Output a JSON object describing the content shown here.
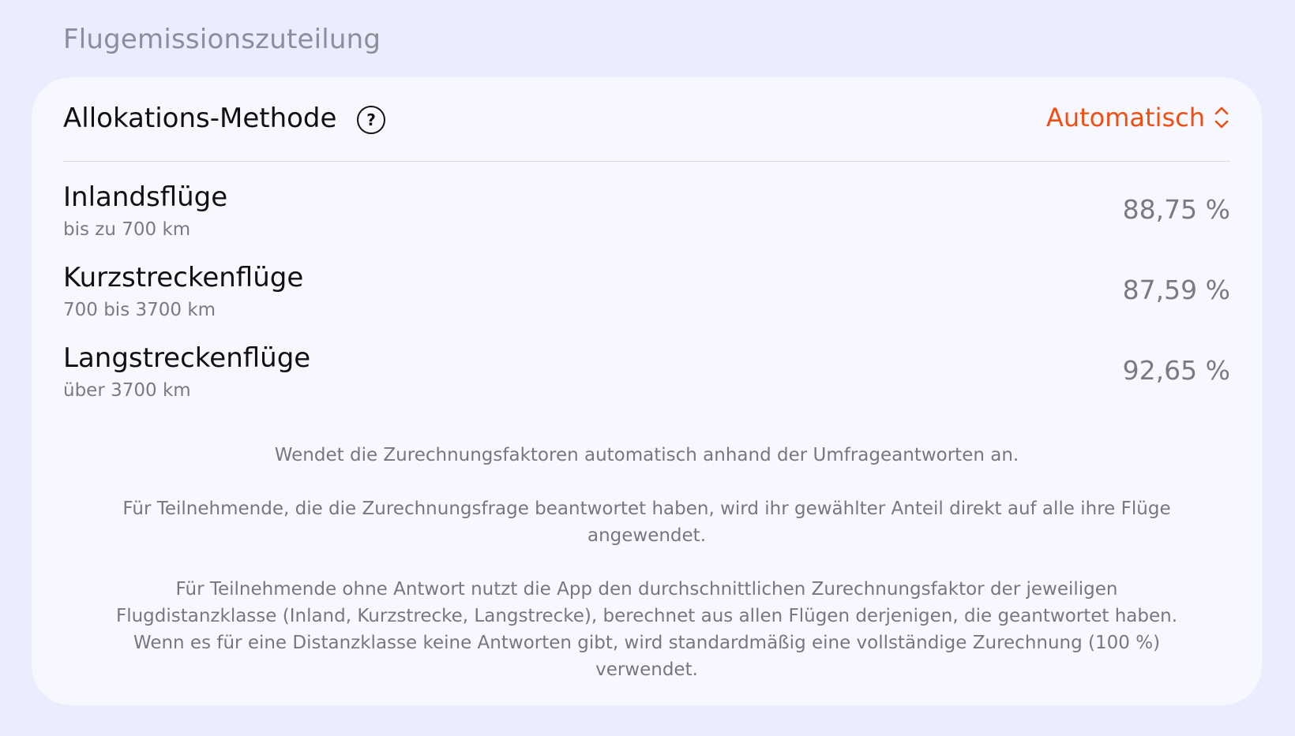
{
  "section_title": "Flugemissionszuteilung",
  "method": {
    "label": "Allokations-Methode",
    "help_icon": "question-circle-icon",
    "value": "Automatisch",
    "value_icon": "chevron-up-down-icon",
    "accent_color": "#F04E12"
  },
  "rows": [
    {
      "title": "Inlandsflüge",
      "subtitle": "bis zu 700 km",
      "value": "88,75 %"
    },
    {
      "title": "Kurzstreckenflüge",
      "subtitle": "700 bis 3700 km",
      "value": "87,59 %"
    },
    {
      "title": "Langstreckenflüge",
      "subtitle": "über 3700 km",
      "value": "92,65 %"
    }
  ],
  "description": {
    "p1": "Wendet die Zurechnungsfaktoren automatisch anhand der Umfrageantworten an.",
    "p2": "Für Teilnehmende, die die Zurechnungsfrage beantwortet haben, wird ihr gewählter Anteil direkt auf alle ihre Flüge angewendet.",
    "p3": "Für Teilnehmende ohne Antwort nutzt die App den durchschnittlichen Zurechnungsfaktor der jeweiligen Flugdistanzklasse (Inland, Kurzstrecke, Langstrecke), berechnet aus allen Flügen derjenigen, die geantwortet haben. Wenn es für eine Distanzklasse keine Antworten gibt, wird standardmäßig eine vollständige Zurechnung (100 %) verwendet."
  }
}
